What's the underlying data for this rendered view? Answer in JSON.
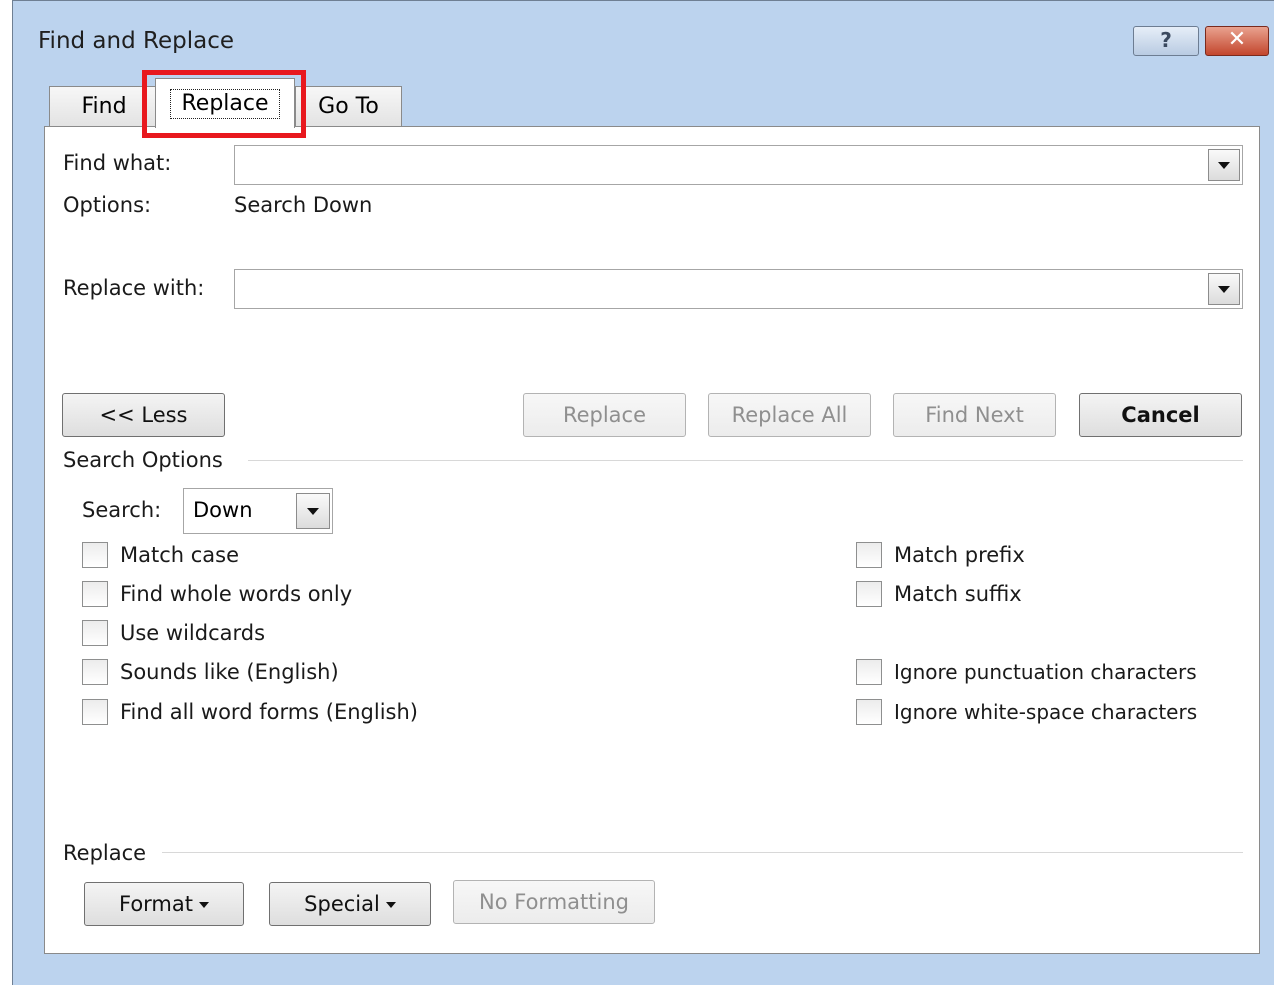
{
  "window": {
    "title": "Find and Replace",
    "help_glyph": "?",
    "close_glyph": "✕"
  },
  "tabs": [
    {
      "label": "Find",
      "active": false
    },
    {
      "label": "Replace",
      "active": true
    },
    {
      "label": "Go To",
      "active": false
    }
  ],
  "find": {
    "label": "Find what:",
    "value": "",
    "options_label": "Options:",
    "options_value": "Search Down"
  },
  "replace": {
    "label": "Replace with:",
    "value": ""
  },
  "buttons": {
    "less": "<< Less",
    "replace": "Replace",
    "replace_all": "Replace All",
    "find_next": "Find Next",
    "cancel": "Cancel"
  },
  "search_options": {
    "title": "Search Options",
    "search_label": "Search:",
    "search_value": "Down",
    "left_checks": [
      {
        "label": "Match case",
        "checked": false
      },
      {
        "label": "Find whole words only",
        "checked": false
      },
      {
        "label": "Use wildcards",
        "checked": false
      },
      {
        "label": "Sounds like (English)",
        "checked": false
      },
      {
        "label": "Find all word forms (English)",
        "checked": false
      }
    ],
    "right_checks": [
      {
        "label": "Match prefix",
        "checked": false
      },
      {
        "label": "Match suffix",
        "checked": false
      },
      {
        "label": "Ignore punctuation characters",
        "checked": false
      },
      {
        "label": "Ignore white-space characters",
        "checked": false
      }
    ]
  },
  "replace_group": {
    "title": "Replace",
    "format": "Format",
    "special": "Special",
    "no_formatting": "No Formatting"
  },
  "colors": {
    "highlight": "#e8181e",
    "dialog_bg": "#bcd3ee"
  }
}
